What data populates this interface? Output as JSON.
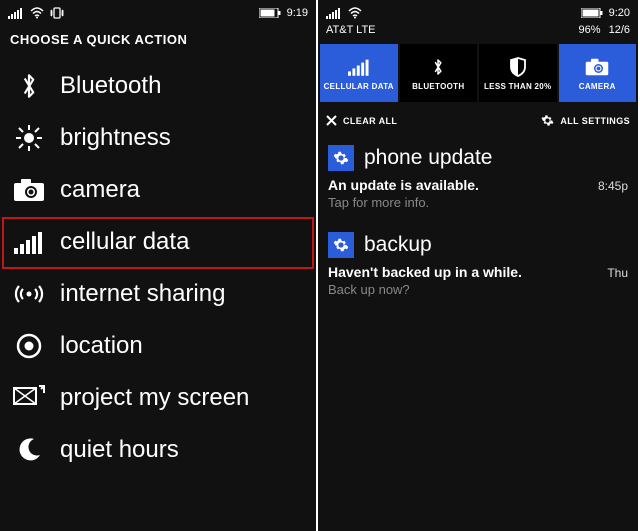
{
  "left": {
    "status": {
      "time": "9:19"
    },
    "heading": "CHOOSE A QUICK ACTION",
    "items": [
      {
        "icon": "bluetooth",
        "label": "Bluetooth"
      },
      {
        "icon": "brightness",
        "label": "brightness"
      },
      {
        "icon": "camera",
        "label": "camera"
      },
      {
        "icon": "cellular",
        "label": "cellular data",
        "highlight": true
      },
      {
        "icon": "sharing",
        "label": "internet sharing"
      },
      {
        "icon": "location",
        "label": "location"
      },
      {
        "icon": "project",
        "label": "project my screen"
      },
      {
        "icon": "quiet",
        "label": "quiet hours"
      }
    ]
  },
  "right": {
    "status": {
      "carrier": "AT&T LTE",
      "time": "9:20",
      "battery_pct": "96%",
      "date": "12/6"
    },
    "tiles": [
      {
        "icon": "cellular",
        "label": "CELLULAR DATA",
        "active": true
      },
      {
        "icon": "bluetooth",
        "label": "BLUETOOTH",
        "active": false
      },
      {
        "icon": "shield",
        "label": "LESS THAN 20%",
        "active": false
      },
      {
        "icon": "camera",
        "label": "CAMERA",
        "active": true
      }
    ],
    "actions": {
      "clear": "CLEAR ALL",
      "settings": "ALL SETTINGS"
    },
    "notifications": [
      {
        "app": "phone update",
        "title": "An update is available.",
        "sub": "Tap for more info.",
        "time": "8:45p"
      },
      {
        "app": "backup",
        "title": "Haven't backed up in a while.",
        "sub": "Back up now?",
        "time": "Thu"
      }
    ]
  }
}
